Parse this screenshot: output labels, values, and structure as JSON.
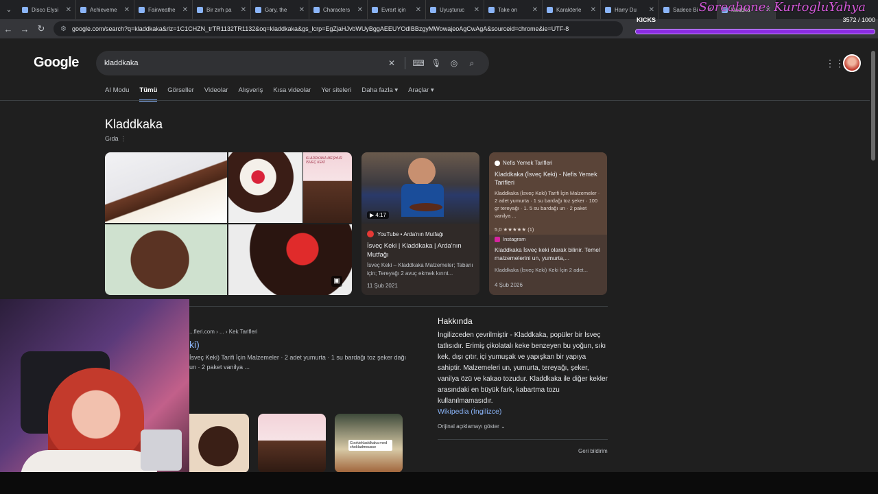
{
  "tabs": [
    {
      "label": "Disco Elysi"
    },
    {
      "label": "Achieveme"
    },
    {
      "label": "Fairweathe"
    },
    {
      "label": "Bir zırh pa"
    },
    {
      "label": "Gary, the"
    },
    {
      "label": "Characters"
    },
    {
      "label": "Evrart için"
    },
    {
      "label": "Uyuşturuc"
    },
    {
      "label": "Take on"
    },
    {
      "label": "Karakterle"
    },
    {
      "label": "Harry Du"
    },
    {
      "label": "Sadece Bi"
    },
    {
      "label": "kladdka"
    }
  ],
  "overlay": {
    "streamer": "Soreabone: KurtogluYahya"
  },
  "address": {
    "url": "google.com/search?q=kladdkaka&rlz=1C1CHZN_trTR1132TR1132&oq=kladdkaka&gs_lcrp=EgZjaHJvbWUyBggAEEUYOdIBBzgyMWowajeoAgCwAgA&sourceid=chrome&ie=UTF-8"
  },
  "kicks": {
    "label": "KICKS",
    "count": "3572 / 1000",
    "progress": 1.0
  },
  "google": {
    "logo": "Google",
    "query": "kladdkaka",
    "tabs": [
      "AI Modu",
      "Tümü",
      "Görseller",
      "Videolar",
      "Alışveriş",
      "Kısa videolar",
      "Yer siteleri",
      "Daha fazla ▾",
      "Araçlar ▾"
    ]
  },
  "knowledge": {
    "title": "Kladdkaka",
    "subtitle": "Gıda"
  },
  "cards": [
    {
      "duration": "▶ 4:17",
      "source": "YouTube • Arda'nın Mutfağı",
      "title": "İsveç Keki | Kladdkaka | Arda'nın Mutfağı",
      "snippet": "İsveç Keki – Kladdkaka Malzemeler; Tabanı için; Tereyağı 2 avuç ekmek kırınt...",
      "date": "11 Şub 2021"
    },
    {
      "source": "Nefis Yemek Tarifleri",
      "title": "Kladdkaka (İsveç Keki) - Nefis Yemek Tarifleri",
      "snippet": "Kladdkaka (İsveç Keki) Tarifi İçin Malzemeler · 2 adet yumurta · 1 su bardağı toz şeker · 100 gr tereyağı · 1. 5 su bardağı un · 2 paket vanilya ...",
      "rating": "5,0 ★★★★★ (1)",
      "source2": "Instagram",
      "title2": "Kladdkaka İsveç keki olarak bilinir. Temel malzemelerini un, yumurta,...",
      "snippet2": "Kladdkaka (İsveç Keki) Keki İçin 2 adet...",
      "date": "4 Şub 2026"
    }
  ],
  "result": {
    "crumb": "...fleri.com › ... › Kek Tarifleri",
    "title": "ki)",
    "snippet": "İsveç Keki) Tarifi İçin Malzemeler · 2 adet yumurta · 1 su bardağı toz şeker dağı un · 2 paket vanilya ..."
  },
  "about": {
    "heading": "Hakkında",
    "body": "İngilizceden çevrilmiştir - Kladdkaka, popüler bir İsveç tatlısıdır. Erimiş çikolatalı keke benzeyen bu yoğun, sıkı kek, dışı çıtır, içi yumuşak ve yapışkan bir yapıya sahiptir. Malzemeleri un, yumurta, tereyağı, şeker, vanilya özü ve kakao tozudur. Kladdkaka ile diğer kekler arasındaki en büyük fark, kabartma tozu kullanılmamasıdır.",
    "link": "Wikipedia (İngilizce)",
    "more": "Orijinal açıklamayı göster ⌄",
    "report": "Geri bildirim"
  },
  "thumb_labels": {
    "t1": "KLADDKAKA MEŞHUR İSVEÇ KEKİ",
    "t2": "Cookiekladdkaka med chokladmousse"
  }
}
